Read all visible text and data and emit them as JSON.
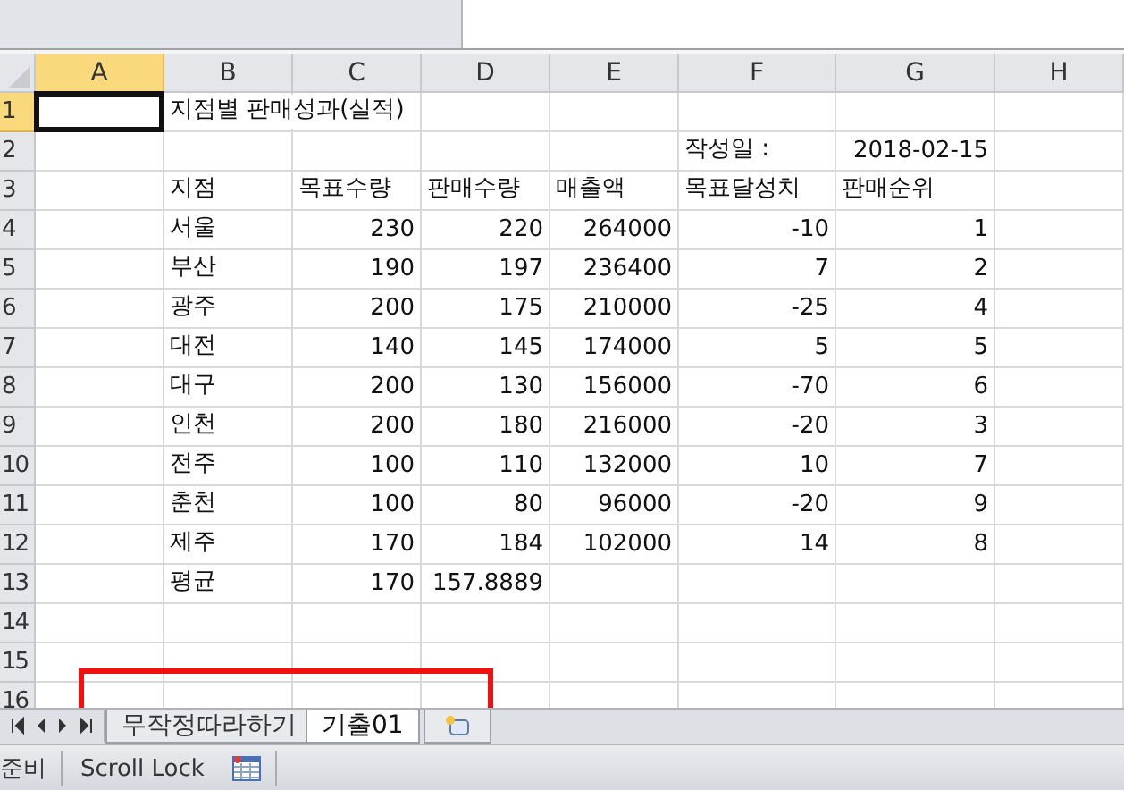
{
  "columns": [
    {
      "label": "A",
      "selected": true
    },
    {
      "label": "B",
      "selected": false
    },
    {
      "label": "C",
      "selected": false
    },
    {
      "label": "D",
      "selected": false
    },
    {
      "label": "E",
      "selected": false
    },
    {
      "label": "F",
      "selected": false
    },
    {
      "label": "G",
      "selected": false
    },
    {
      "label": "H",
      "selected": false
    }
  ],
  "rows": [
    {
      "label": "1",
      "selected": true,
      "cells": [
        {
          "text": null,
          "selected": true
        },
        {
          "text": "지점별 판매성과(실적)",
          "kind": "text"
        },
        null,
        null,
        null,
        null,
        null,
        null
      ]
    },
    {
      "label": "2",
      "selected": false,
      "cells": [
        null,
        null,
        null,
        null,
        null,
        {
          "text": "작성일 :",
          "kind": "text"
        },
        {
          "text": "2018-02-15",
          "kind": "number"
        },
        null
      ]
    },
    {
      "label": "3",
      "selected": false,
      "cells": [
        null,
        {
          "text": "지점",
          "kind": "text"
        },
        {
          "text": "목표수량",
          "kind": "text"
        },
        {
          "text": "판매수량",
          "kind": "text"
        },
        {
          "text": "매출액",
          "kind": "text"
        },
        {
          "text": "목표달성치",
          "kind": "text"
        },
        {
          "text": "판매순위",
          "kind": "text"
        },
        null
      ]
    },
    {
      "label": "4",
      "selected": false,
      "cells": [
        null,
        {
          "text": "서울",
          "kind": "text"
        },
        {
          "text": "230",
          "kind": "number"
        },
        {
          "text": "220",
          "kind": "number"
        },
        {
          "text": "264000",
          "kind": "number"
        },
        {
          "text": "-10",
          "kind": "number"
        },
        {
          "text": "1",
          "kind": "number"
        },
        null
      ]
    },
    {
      "label": "5",
      "selected": false,
      "cells": [
        null,
        {
          "text": "부산",
          "kind": "text"
        },
        {
          "text": "190",
          "kind": "number"
        },
        {
          "text": "197",
          "kind": "number"
        },
        {
          "text": "236400",
          "kind": "number"
        },
        {
          "text": "7",
          "kind": "number"
        },
        {
          "text": "2",
          "kind": "number"
        },
        null
      ]
    },
    {
      "label": "6",
      "selected": false,
      "cells": [
        null,
        {
          "text": "광주",
          "kind": "text"
        },
        {
          "text": "200",
          "kind": "number"
        },
        {
          "text": "175",
          "kind": "number"
        },
        {
          "text": "210000",
          "kind": "number"
        },
        {
          "text": "-25",
          "kind": "number"
        },
        {
          "text": "4",
          "kind": "number"
        },
        null
      ]
    },
    {
      "label": "7",
      "selected": false,
      "cells": [
        null,
        {
          "text": "대전",
          "kind": "text"
        },
        {
          "text": "140",
          "kind": "number"
        },
        {
          "text": "145",
          "kind": "number"
        },
        {
          "text": "174000",
          "kind": "number"
        },
        {
          "text": "5",
          "kind": "number"
        },
        {
          "text": "5",
          "kind": "number"
        },
        null
      ]
    },
    {
      "label": "8",
      "selected": false,
      "cells": [
        null,
        {
          "text": "대구",
          "kind": "text"
        },
        {
          "text": "200",
          "kind": "number"
        },
        {
          "text": "130",
          "kind": "number"
        },
        {
          "text": "156000",
          "kind": "number"
        },
        {
          "text": "-70",
          "kind": "number"
        },
        {
          "text": "6",
          "kind": "number"
        },
        null
      ]
    },
    {
      "label": "9",
      "selected": false,
      "cells": [
        null,
        {
          "text": "인천",
          "kind": "text"
        },
        {
          "text": "200",
          "kind": "number"
        },
        {
          "text": "180",
          "kind": "number"
        },
        {
          "text": "216000",
          "kind": "number"
        },
        {
          "text": "-20",
          "kind": "number"
        },
        {
          "text": "3",
          "kind": "number"
        },
        null
      ]
    },
    {
      "label": "10",
      "selected": false,
      "cells": [
        null,
        {
          "text": "전주",
          "kind": "text"
        },
        {
          "text": "100",
          "kind": "number"
        },
        {
          "text": "110",
          "kind": "number"
        },
        {
          "text": "132000",
          "kind": "number"
        },
        {
          "text": "10",
          "kind": "number"
        },
        {
          "text": "7",
          "kind": "number"
        },
        null
      ]
    },
    {
      "label": "11",
      "selected": false,
      "cells": [
        null,
        {
          "text": "춘천",
          "kind": "text"
        },
        {
          "text": "100",
          "kind": "number"
        },
        {
          "text": "80",
          "kind": "number"
        },
        {
          "text": "96000",
          "kind": "number"
        },
        {
          "text": "-20",
          "kind": "number"
        },
        {
          "text": "9",
          "kind": "number"
        },
        null
      ]
    },
    {
      "label": "12",
      "selected": false,
      "cells": [
        null,
        {
          "text": "제주",
          "kind": "text"
        },
        {
          "text": "170",
          "kind": "number"
        },
        {
          "text": "184",
          "kind": "number"
        },
        {
          "text": "102000",
          "kind": "number"
        },
        {
          "text": "14",
          "kind": "number"
        },
        {
          "text": "8",
          "kind": "number"
        },
        null
      ]
    },
    {
      "label": "13",
      "selected": false,
      "cells": [
        null,
        {
          "text": "평균",
          "kind": "text"
        },
        {
          "text": "170",
          "kind": "number"
        },
        {
          "text": "157.8889",
          "kind": "number"
        },
        null,
        null,
        null,
        null
      ]
    },
    {
      "label": "14",
      "selected": false,
      "cells": [
        null,
        null,
        null,
        null,
        null,
        null,
        null,
        null
      ]
    },
    {
      "label": "15",
      "selected": false,
      "cells": [
        null,
        null,
        null,
        null,
        null,
        null,
        null,
        null
      ]
    },
    {
      "label": "16",
      "selected": false,
      "cells": [
        null,
        null,
        null,
        null,
        null,
        null,
        null,
        null
      ]
    }
  ],
  "sheet_tabs": [
    {
      "label": "무작정따라하기",
      "selected": false
    },
    {
      "label": "기출01",
      "selected": true
    }
  ],
  "status_bar": {
    "mode": "준비",
    "scroll_lock": "Scroll Lock"
  }
}
